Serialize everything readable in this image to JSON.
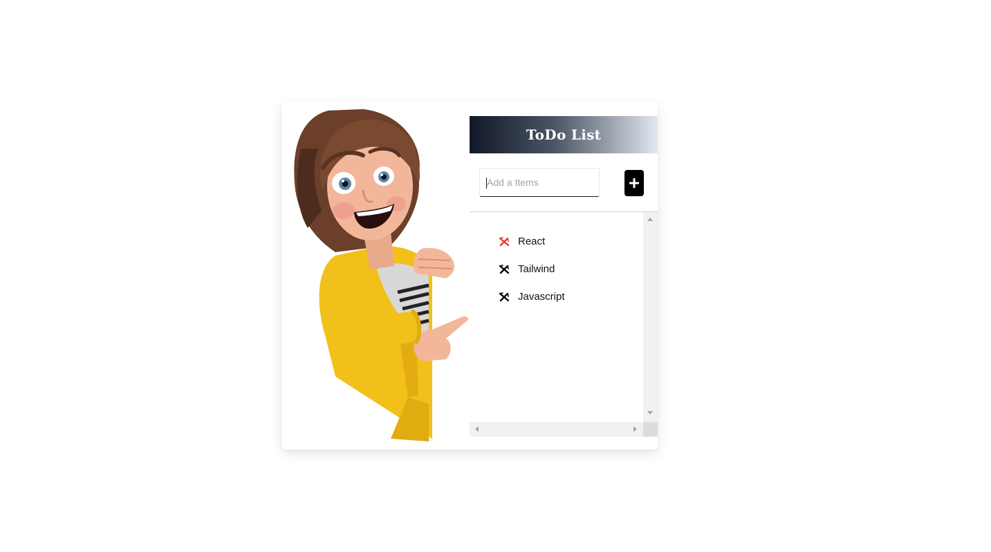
{
  "app": {
    "title": "ToDo List"
  },
  "add_item": {
    "placeholder": "Add a Items",
    "value": "",
    "button_icon": "plus-icon"
  },
  "items": [
    {
      "label": "React",
      "icon": "delete-icon",
      "icon_color": "#e53935"
    },
    {
      "label": "Tailwind",
      "icon": "delete-icon",
      "icon_color": "#000000"
    },
    {
      "label": "Javascript",
      "icon": "delete-icon",
      "icon_color": "#000000"
    }
  ],
  "colors": {
    "header_gradient_start": "#111827",
    "header_gradient_end": "#e2e8f0",
    "button_bg": "#000000",
    "jacket": "#f2c01a"
  },
  "illustration": {
    "icon": "cartoon-woman-pointing-illustration"
  }
}
